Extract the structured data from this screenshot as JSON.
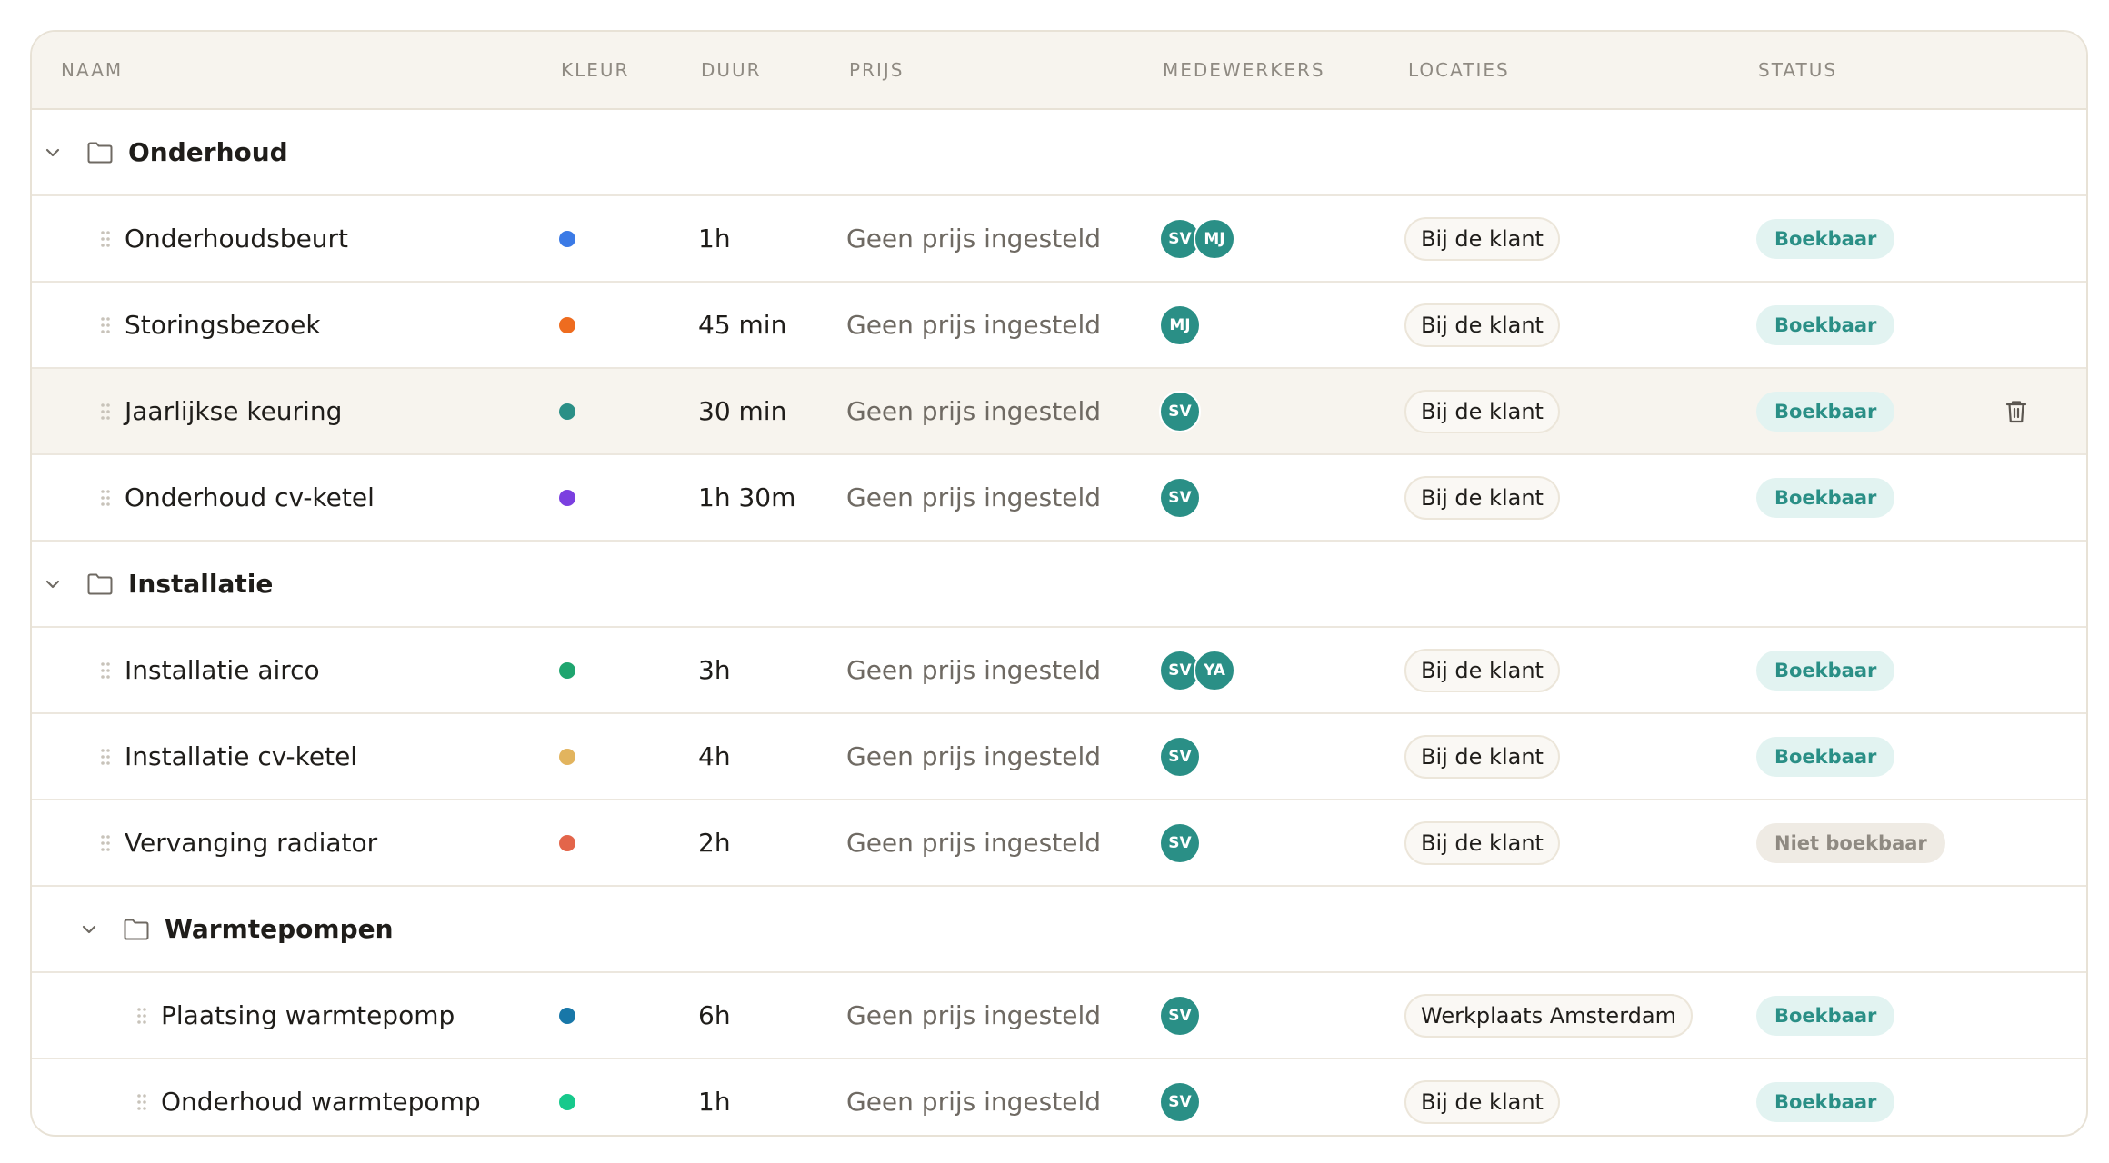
{
  "columns": {
    "name": "NAAM",
    "color": "KLEUR",
    "duration": "DUUR",
    "price": "PRIJS",
    "staff": "MEDEWERKERS",
    "locations": "LOCATIES",
    "status": "STATUS"
  },
  "rows": [
    {
      "kind": "group",
      "level": 0,
      "name": "Onderhoud",
      "icon": "folder-icon",
      "expanded": true
    },
    {
      "kind": "service",
      "level": 0,
      "name": "Onderhoudsbeurt",
      "color": "#3b7ae6",
      "duration": "1h",
      "price": "Geen prijs ingesteld",
      "staff": [
        "SV",
        "MJ"
      ],
      "location": "Bij de klant",
      "status": "Boekbaar",
      "bookable": true
    },
    {
      "kind": "service",
      "level": 0,
      "name": "Storingsbezoek",
      "color": "#ee6c1f",
      "duration": "45 min",
      "price": "Geen prijs ingesteld",
      "staff": [
        "MJ"
      ],
      "location": "Bij de klant",
      "status": "Boekbaar",
      "bookable": true
    },
    {
      "kind": "service",
      "level": 0,
      "name": "Jaarlijkse keuring",
      "color": "#2b8f86",
      "duration": "30 min",
      "price": "Geen prijs ingesteld",
      "staff": [
        "SV"
      ],
      "location": "Bij de klant",
      "status": "Boekbaar",
      "bookable": true,
      "hover": true
    },
    {
      "kind": "service",
      "level": 0,
      "name": "Onderhoud cv-ketel",
      "color": "#7b3fe0",
      "duration": "1h 30m",
      "price": "Geen prijs ingesteld",
      "staff": [
        "SV"
      ],
      "location": "Bij de klant",
      "status": "Boekbaar",
      "bookable": true
    },
    {
      "kind": "group",
      "level": 0,
      "name": "Installatie",
      "icon": "folder-icon",
      "expanded": true
    },
    {
      "kind": "service",
      "level": 0,
      "name": "Installatie airco",
      "color": "#1fa56f",
      "duration": "3h",
      "price": "Geen prijs ingesteld",
      "staff": [
        "SV",
        "YA"
      ],
      "location": "Bij de klant",
      "status": "Boekbaar",
      "bookable": true
    },
    {
      "kind": "service",
      "level": 0,
      "name": "Installatie cv-ketel",
      "color": "#e2b45e",
      "duration": "4h",
      "price": "Geen prijs ingesteld",
      "staff": [
        "SV"
      ],
      "location": "Bij de klant",
      "status": "Boekbaar",
      "bookable": true
    },
    {
      "kind": "service",
      "level": 0,
      "name": "Vervanging radiator",
      "color": "#e3654a",
      "duration": "2h",
      "price": "Geen prijs ingesteld",
      "staff": [
        "SV"
      ],
      "location": "Bij de klant",
      "status": "Niet boekbaar",
      "bookable": false
    },
    {
      "kind": "group",
      "level": 1,
      "name": "Warmtepompen",
      "icon": "folder-icon",
      "expanded": true
    },
    {
      "kind": "service",
      "level": 1,
      "name": "Plaatsing warmtepomp",
      "color": "#1877a8",
      "duration": "6h",
      "price": "Geen prijs ingesteld",
      "staff": [
        "SV"
      ],
      "location": "Werkplaats Amsterdam",
      "status": "Boekbaar",
      "bookable": true
    },
    {
      "kind": "service",
      "level": 1,
      "name": "Onderhoud warmtepomp",
      "color": "#17c98c",
      "duration": "1h",
      "price": "Geen prijs ingesteld",
      "staff": [
        "SV"
      ],
      "location": "Bij de klant",
      "status": "Boekbaar",
      "bookable": true
    }
  ],
  "icons": {
    "expand": "chevron-down-icon",
    "folder": "folder-icon",
    "drag": "drag-handle-icon",
    "delete": "trash-icon"
  }
}
